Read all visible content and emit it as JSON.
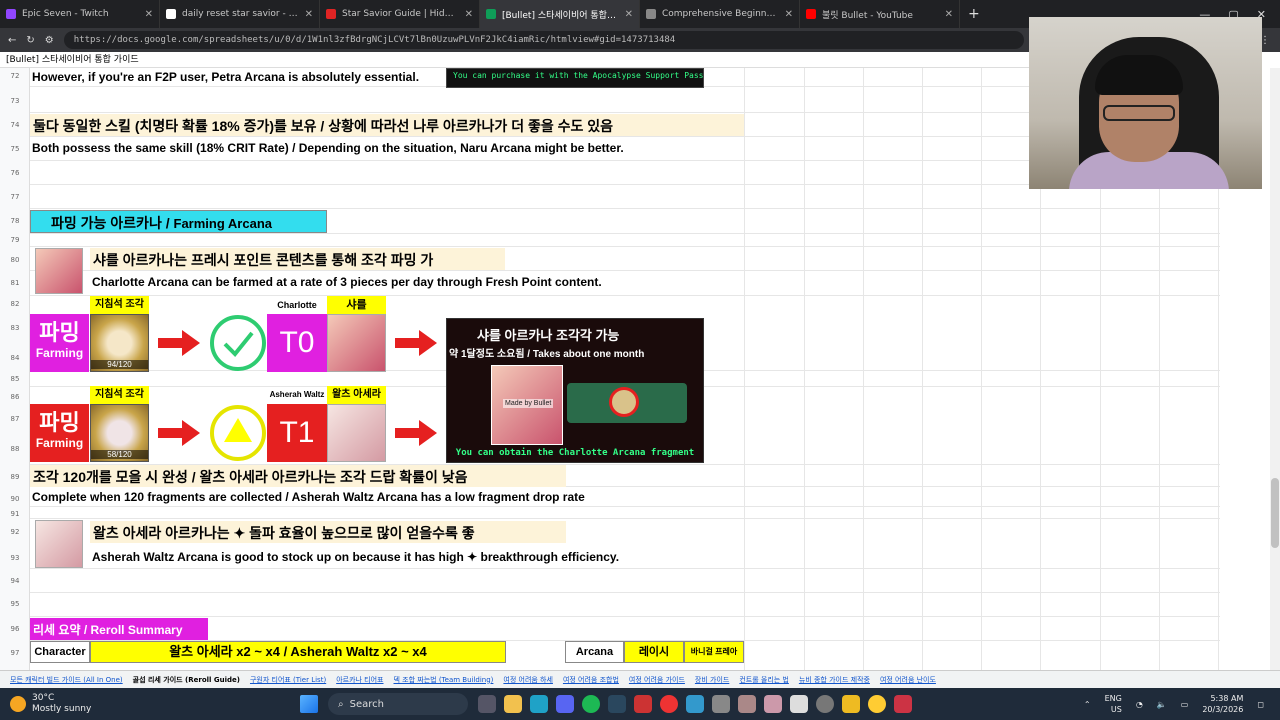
{
  "browser": {
    "tabs": [
      {
        "label": "Epic Seven - Twitch",
        "color": "#9146ff"
      },
      {
        "label": "daily reset star savior - Google Se",
        "color": "#ffffff"
      },
      {
        "label": "Star Savior Guide | Hideout Guides",
        "color": "#e02424"
      },
      {
        "label": "[Bullet] 스타세이비어 통합 가이드",
        "color": "#0f9d58"
      },
      {
        "label": "Comprehensive Beginner Guide |",
        "color": "#888888"
      },
      {
        "label": "불릿 Bullet - YouTube",
        "color": "#ff0000"
      }
    ],
    "url": "https://docs.google.com/spreadsheets/u/0/d/1W1nl3zfBdrgNCjLCVt7lBn0UzuwPLVnF2JkC4iamRic/htmlview#gid=1473713484"
  },
  "doc_title": "[Bullet] 스타세이비어 통합 가이드",
  "rows": [
    "72",
    "73",
    "74",
    "75",
    "76",
    "77",
    "78",
    "79",
    "80",
    "81",
    "82",
    "83",
    "84",
    "85",
    "86",
    "87",
    "88",
    "89",
    "90",
    "91",
    "92",
    "93",
    "94",
    "95",
    "96",
    "97"
  ],
  "content": {
    "r72": "However, if you're an F2P user, Petra Arcana is absolutely essential.",
    "r72_banner": "You can purchase it with the Apocalypse Support Pass",
    "r74": "둘다 동일한 스킬 (치명타 확률 18% 증가)를 보유 / 상황에 따라선 나루 아르카나가 더 좋을 수도 있음",
    "r75": "Both possess the same skill (18% CRIT Rate) / Depending on the situation, Naru Arcana might be better.",
    "farming_header_ko": "파밍 가능 아르카나 / ",
    "farming_header_en": "Farming Arcana",
    "r80": "샤를 아르카나는 프레시 포인트 콘텐츠를 통해 조각 파밍 가",
    "r81": "Charlotte Arcana can be farmed at a rate of 3 pieces per day through Fresh Point content.",
    "lbl_shard1": "지침석 조각",
    "lbl_charlotte": "Charlotte",
    "lbl_charlotte_ko": "샤를",
    "farm_ko": "파밍",
    "farm_en": "Farming",
    "count1": "94/120",
    "tier0": "T0",
    "lbl_shard2": "지침석 조각",
    "lbl_asherah": "Asherah Waltz",
    "lbl_asherah_ko": "왈츠 아세라",
    "count2": "58/120",
    "tier1": "T1",
    "promo_title": "샤를 아르카나 조각각 가능",
    "promo_sub": "약 1달정도 소요됨 / Takes about one month",
    "promo_made": "Made by Bullet",
    "promo_bottom": "You can obtain the Charlotte Arcana fragment",
    "r89": "조각 120개를 모을 시 완성 / 왈츠 아세라 아르카나는 조각 드랍 확률이 낮음",
    "r90": "Complete when 120 fragments are collected / Asherah Waltz Arcana has a low fragment drop rate",
    "r92": "왈츠 아세라 아르카나는 ✦ 돌파 효율이 높으므로 많이 얻을수록 좋",
    "r93": "Asherah Waltz Arcana is good to stock up on because it has high ✦ breakthrough efficiency.",
    "reroll_header": "리세 요약 / Reroll Summary",
    "col_character": "Character",
    "col_main": "왈츠 아세라 x2 ~ x4 / Asherah Waltz x2 ~ x4",
    "col_arcana": "Arcana",
    "col_raisy": "레이시",
    "col_vanity": "바니걸 프레아"
  },
  "sheet_tabs": [
    "모든 캐릭터 빌드 가이드 (All In One)",
    "골섭 리세 가이드 (Reroll Guide)",
    "구원자 티어표 (Tier List)",
    "아르카나 티어표",
    "덱 조합 짜는법 (Team Building)",
    "여정 어려움 하세",
    "여정 어려움 조합법",
    "여정 어려움 가이드",
    "장비 가이드",
    "컨트롤 올리는 법",
    "뉴비 종합 가이드 제작중",
    "여정 어려움 난이도"
  ],
  "active_sheet_tab": 1,
  "taskbar": {
    "temp": "30°C",
    "weather": "Mostly sunny",
    "search": "Search",
    "lang1": "ENG",
    "lang2": "US",
    "time": "5:38 AM",
    "date": "20/3/2026"
  },
  "colors": {
    "cyan": "#33ddee",
    "magenta": "#e020e0",
    "red": "#e52020",
    "yellow": "#ffff00",
    "cream": "#fdf3d9",
    "green_ring": "#2ecc71"
  }
}
